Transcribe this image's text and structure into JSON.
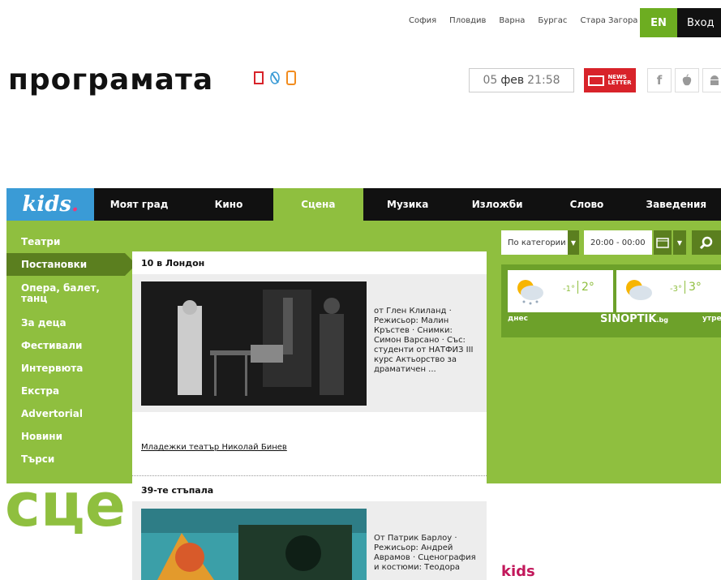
{
  "cities": [
    "София",
    "Пловдив",
    "Варна",
    "Бургас",
    "Стара Загора"
  ],
  "header": {
    "lang": "EN",
    "login": "Вход",
    "logo": "програмата"
  },
  "date": {
    "day": "05",
    "month": "фев",
    "time": "21:58"
  },
  "newsletter": {
    "line1": "NEWS",
    "line2": "LETTER"
  },
  "social": [
    {
      "name": "facebook",
      "glyph": "f"
    },
    {
      "name": "apple",
      "glyph": ""
    },
    {
      "name": "android",
      "glyph": "▲"
    }
  ],
  "nav": {
    "kids_label": "kids",
    "kids_dot": ".",
    "items": [
      "Моят град",
      "Кино",
      "Сцена",
      "Музика",
      "Изложби",
      "Слово",
      "Заведения"
    ],
    "active": "Сцена"
  },
  "sidebar": {
    "items": [
      "Театри",
      "Постановки",
      "Опера, балет, танц",
      "За деца",
      "Фестивали",
      "Интервюта",
      "Екстра",
      "Advertorial",
      "Новини",
      "Търси"
    ],
    "active": "Постановки"
  },
  "filters": {
    "category": "По категории",
    "time": "20:00 - 00:00"
  },
  "weather": {
    "today": {
      "label": "днес",
      "low": "-1°",
      "high": "2°"
    },
    "tomorrow": {
      "label": "утре",
      "low": "-3°",
      "high": "3°"
    },
    "brand": "SINOPTIK",
    "brand_suffix": ".bg"
  },
  "articles": [
    {
      "title": "10 в Лондон",
      "desc": "от Глен Клиланд · Режисьор: Малин Кръстев · Снимки: Симон Варсано · Със: студенти от НАТФИЗ III курс Актьорство за драматичен ...",
      "venue": "Младежки театър Николай Бинев"
    },
    {
      "title": "39-те стъпала",
      "desc": "От Патрик Барлоу · Режисьор: Андрей Аврамов · Сценография и костюми: Теодора"
    }
  ],
  "decor": {
    "big_word": "сце",
    "kids_word": "kids"
  },
  "colors": {
    "green": "#8fbf3f",
    "dark_green": "#5b7f1f",
    "kids_blue": "#3a9bd6",
    "red": "#d8232a"
  }
}
